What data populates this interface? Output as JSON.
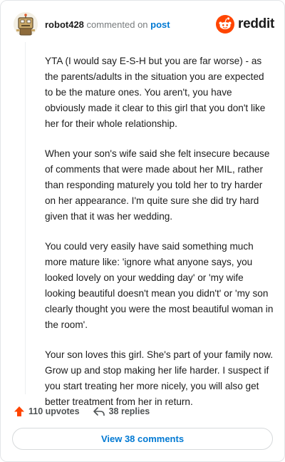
{
  "header": {
    "username": "robot428",
    "commented_on": "commented on",
    "post_link": "post",
    "brand": "reddit"
  },
  "comment": {
    "paragraphs": [
      "YTA (I would say E-S-H but you are far worse) - as the parents/adults in the situation you are expected to be the mature ones. You aren't, you have obviously made it clear to this girl that you don't like her for their whole relationship.",
      "When your son's wife said she felt insecure because of comments that were made about her MIL, rather than responding maturely you told her to try harder on her appearance. I'm quite sure she did try hard given that it was her wedding.",
      "You could very easily have said something much more mature like: 'ignore what anyone says, you looked lovely on your wedding day' or 'my wife looking beautiful doesn't mean you didn't' or 'my son clearly thought you were the most beautiful woman in the room'.",
      "Your son loves this girl. She's part of your family now. Grow up and stop making her life harder. I suspect if you start treating her more nicely, you will also get better treatment from her in return."
    ]
  },
  "actions": {
    "upvotes": "110 upvotes",
    "replies": "38 replies"
  },
  "footer": {
    "view_comments": "View 38 comments"
  },
  "colors": {
    "brand_orange": "#ff4500",
    "link_blue": "#0079d3",
    "text": "#1c1c1c",
    "muted": "#787c7e"
  },
  "icons": {
    "avatar": "robot-avatar-icon",
    "logo": "reddit-snoo-icon",
    "upvote": "upvote-arrow-icon",
    "reply": "reply-arrow-icon"
  }
}
